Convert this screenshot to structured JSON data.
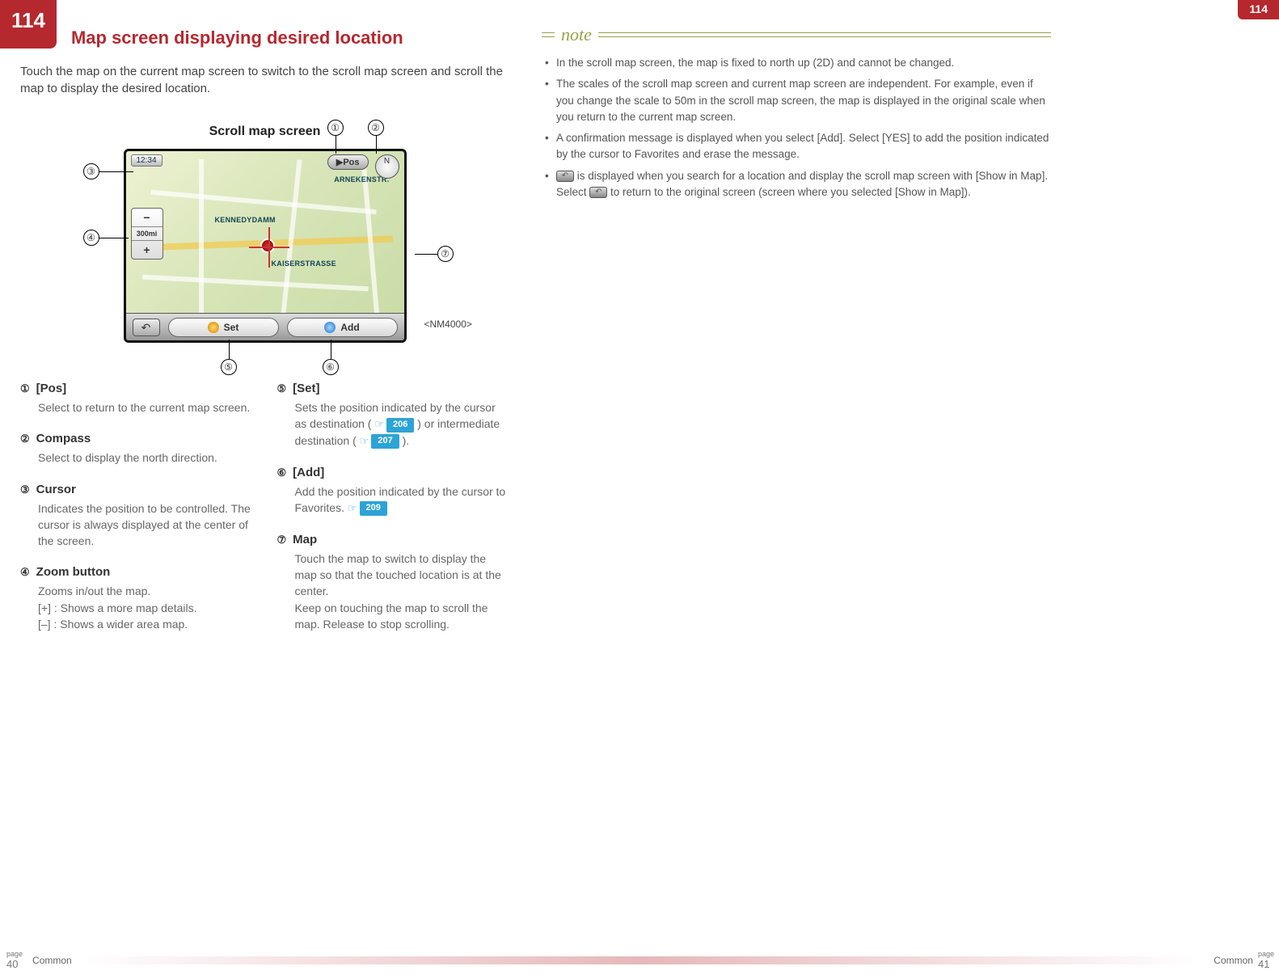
{
  "corner_page": "114",
  "header": {
    "badge": "114",
    "title": "Map screen displaying desired location"
  },
  "intro": "Touch the map on the current map screen to switch to the scroll map screen and scroll the map to display the desired location.",
  "figure": {
    "caption": "Scroll map screen",
    "device_label": "<NM4000>",
    "clock": "12:34",
    "pos_button": "▶Pos",
    "compass": "N",
    "zoom_distance": "300mi",
    "zoom_minus": "−",
    "zoom_plus": "+",
    "street1": "ARNEKENSTR.",
    "street2": "KENNEDYDAMM",
    "street3": "KAISERSTRASSE",
    "set_button": "Set",
    "add_button": "Add",
    "back_arrow": "↶",
    "callouts": {
      "c1": "①",
      "c2": "②",
      "c3": "③",
      "c4": "④",
      "c5": "⑤",
      "c6": "⑥",
      "c7": "⑦"
    }
  },
  "desc_left": [
    {
      "num": "①",
      "title": "[Pos]",
      "body": "Select to return to the current map screen."
    },
    {
      "num": "②",
      "title": "Compass",
      "body": "Select to display the north direction."
    },
    {
      "num": "③",
      "title": "Cursor",
      "body": "Indicates the position to be controlled. The cursor is always displayed at the center of the screen."
    },
    {
      "num": "④",
      "title": "Zoom button",
      "body_lines": [
        "Zooms in/out the map.",
        "[+] : Shows a more map details.",
        "[–] : Shows a wider area map."
      ]
    }
  ],
  "desc_right": [
    {
      "num": "⑤",
      "title": "[Set]",
      "body_pre": "Sets the position indicated by the cursor as destination (",
      "ref1": "206",
      "body_mid": ") or intermediate destination (",
      "ref2": "207",
      "body_post": ")."
    },
    {
      "num": "⑥",
      "title": "[Add]",
      "body_pre": "Add the position indicated by the cursor to Favorites. ",
      "ref1": "209"
    },
    {
      "num": "⑦",
      "title": "Map",
      "body_lines": [
        "Touch the map to switch to display the map so that the touched location is at the center.",
        "Keep on touching the map to scroll the map. Release to stop scrolling."
      ]
    }
  ],
  "note": {
    "label": "note",
    "items": [
      "In the scroll map screen, the map is fixed to north up (2D) and cannot be changed.",
      "The scales of the scroll map screen and current map screen are independent. For example, even if you change the scale to 50m in the scroll map screen, the map is displayed in the original scale when you return to the current map screen.",
      "A confirmation message is displayed when you select [Add]. Select [YES] to add the position indicated by the cursor to Favorites and erase the message."
    ],
    "item4_pre": "",
    "item4_mid": " is displayed when you search for a location and display the scroll map screen with [Show in Map]. Select ",
    "item4_post": " to return to the original screen (screen where you selected [Show in Map])."
  },
  "footer": {
    "page_label": "page",
    "left_page": "40",
    "right_page": "41",
    "section": "Common"
  },
  "ref_hand": "☞"
}
